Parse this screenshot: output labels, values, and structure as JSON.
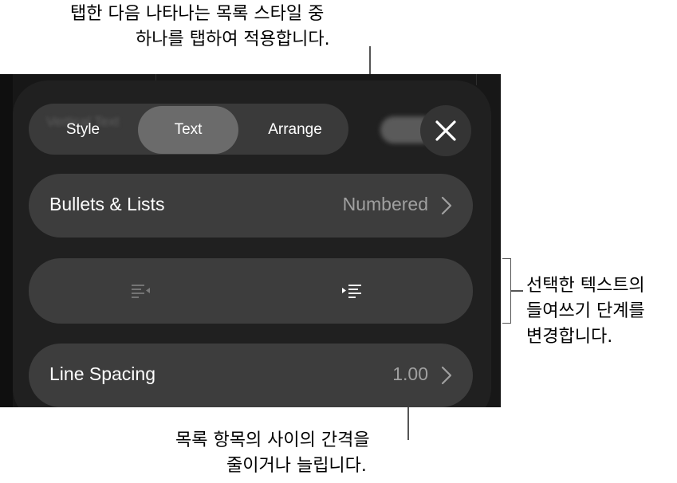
{
  "callouts": {
    "top_line1": "탭한 다음 나타나는 목록 스타일 중",
    "top_line2": "하나를 탭하여 적용합니다.",
    "right_line1": "선택한 텍스트의",
    "right_line2": "들여쓰기 단계를",
    "right_line3": "변경합니다.",
    "bottom_line1": "목록 항목의 사이의 간격을",
    "bottom_line2": "줄이거나 늘립니다."
  },
  "tabs": {
    "items": [
      {
        "label": "Style",
        "selected": false
      },
      {
        "label": "Text",
        "selected": true
      },
      {
        "label": "Arrange",
        "selected": false
      }
    ],
    "ghost_text": "Vertical Text"
  },
  "bullets_row": {
    "label": "Bullets & Lists",
    "value": "Numbered"
  },
  "indent_row": {
    "decrease_icon": "decrease-indent-icon",
    "increase_icon": "increase-indent-icon"
  },
  "spacing_row": {
    "label": "Line Spacing",
    "value": "1.00"
  },
  "colors": {
    "panel": "#202020",
    "row": "#3d3d3d",
    "selected_tab": "#6b6b6b",
    "secondary_text": "#a0a0a0"
  }
}
